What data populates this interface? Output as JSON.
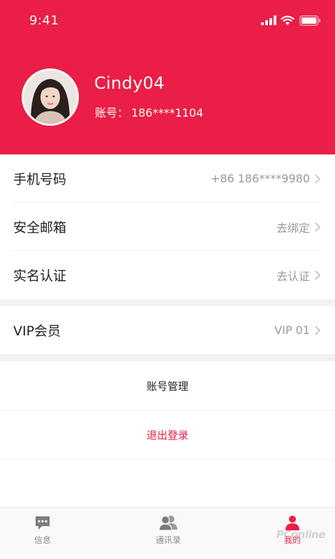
{
  "status_bar": {
    "time": "9:41"
  },
  "profile": {
    "username": "Cindy04",
    "account_label": "账号",
    "account_value": "186****1104"
  },
  "settings": {
    "phone": {
      "label": "手机号码",
      "value": "+86 186****9980"
    },
    "email": {
      "label": "安全邮箱",
      "value": "去绑定"
    },
    "realname": {
      "label": "实名认证",
      "value": "去认证"
    },
    "vip": {
      "label": "VIP会员",
      "value": "VIP 01"
    }
  },
  "actions": {
    "account_management": "账号管理",
    "logout": "退出登录"
  },
  "tabbar": {
    "items": [
      {
        "label": "信息",
        "icon": "chat-bubble-icon"
      },
      {
        "label": "通讯录",
        "icon": "contacts-icon"
      },
      {
        "label": "我的",
        "icon": "profile-icon"
      }
    ]
  },
  "watermark": "PConline",
  "colors": {
    "brand": "#ea1e46",
    "background_gap": "#f2f2f5",
    "label_text": "#222222",
    "secondary_text": "#999999",
    "tab_inactive": "#8a8a8a"
  }
}
